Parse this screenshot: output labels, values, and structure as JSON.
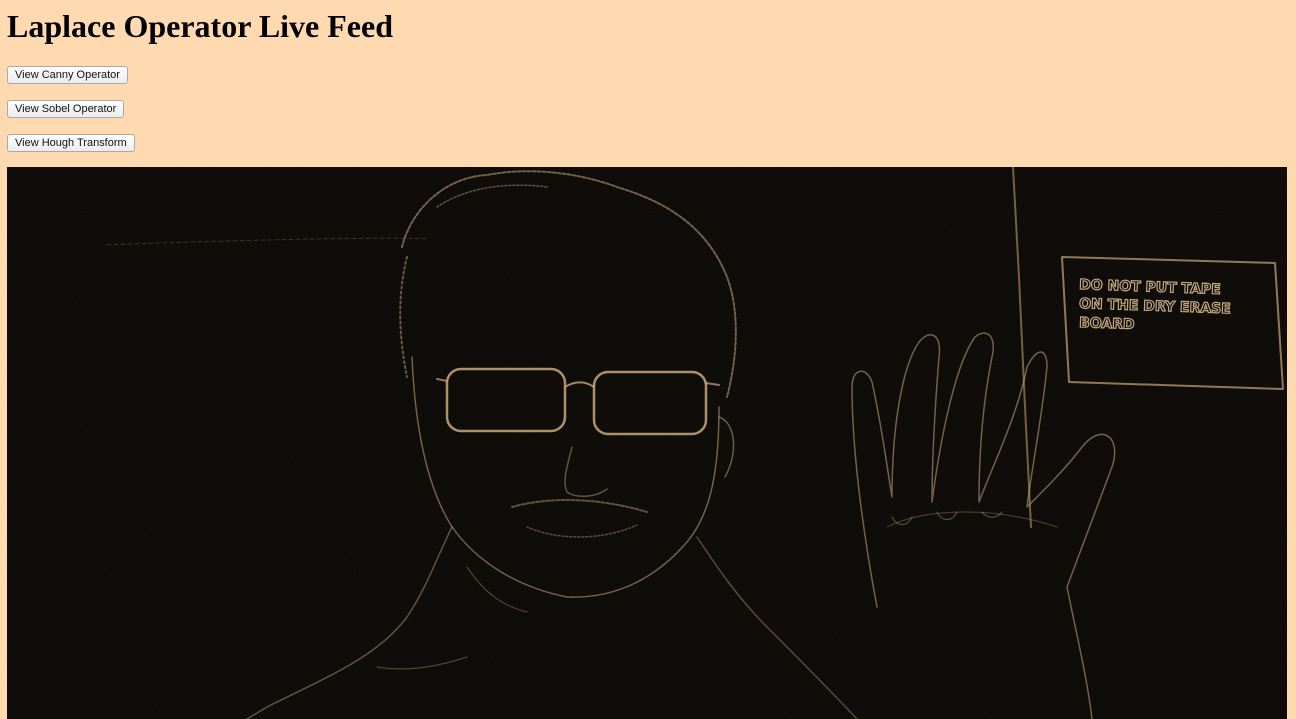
{
  "page": {
    "title": "Laplace Operator Live Feed",
    "background": "#ffdab0"
  },
  "buttons": {
    "canny": "View Canny Operator",
    "sobel": "View Sobel Operator",
    "hough": "View Hough Transform"
  },
  "feed": {
    "sign_lines": [
      "DO NOT PUT TAPE",
      "ON THE DRY ERASE",
      "BOARD"
    ],
    "edge_color": "#c9a77c",
    "background": "#090705"
  }
}
